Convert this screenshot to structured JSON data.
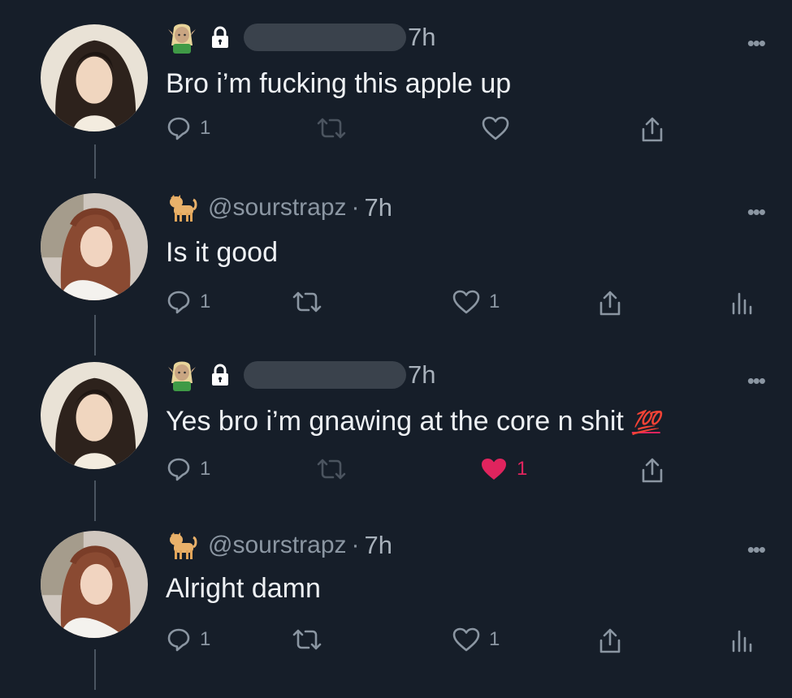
{
  "tweets": [
    {
      "kind": "locked",
      "time": "7h",
      "text": "Bro i’m fucking this apple up",
      "reply_count": "1",
      "retweet_count": "",
      "like_count": "",
      "liked": false,
      "show_analytics": false
    },
    {
      "kind": "handle",
      "handle": "@sourstrapz",
      "separator": "·",
      "time": "7h",
      "text": "Is it good",
      "reply_count": "1",
      "retweet_count": "",
      "like_count": "1",
      "liked": false,
      "show_analytics": true
    },
    {
      "kind": "locked",
      "time": "7h",
      "text": "Yes bro i’m gnawing at the core n shit",
      "text_emoji": "💯",
      "reply_count": "1",
      "retweet_count": "",
      "like_count": "1",
      "liked": true,
      "show_analytics": false
    },
    {
      "kind": "handle",
      "handle": "@sourstrapz",
      "separator": "·",
      "time": "7h",
      "text": "Alright damn",
      "reply_count": "1",
      "retweet_count": "",
      "like_count": "1",
      "liked": false,
      "show_analytics": true
    }
  ],
  "more_glyph": "•••",
  "icons": {
    "reply": "reply-icon",
    "retweet": "retweet-icon",
    "like": "heart-icon",
    "share": "share-icon",
    "analytics": "analytics-icon",
    "lock": "lock-icon",
    "elf_emoji": "elf-emoji-icon",
    "cat_emoji": "cat-emoji-icon"
  },
  "colors": {
    "background": "#161e29",
    "muted": "#8b96a2",
    "text": "#eef1f4",
    "like_active": "#e0245e"
  }
}
